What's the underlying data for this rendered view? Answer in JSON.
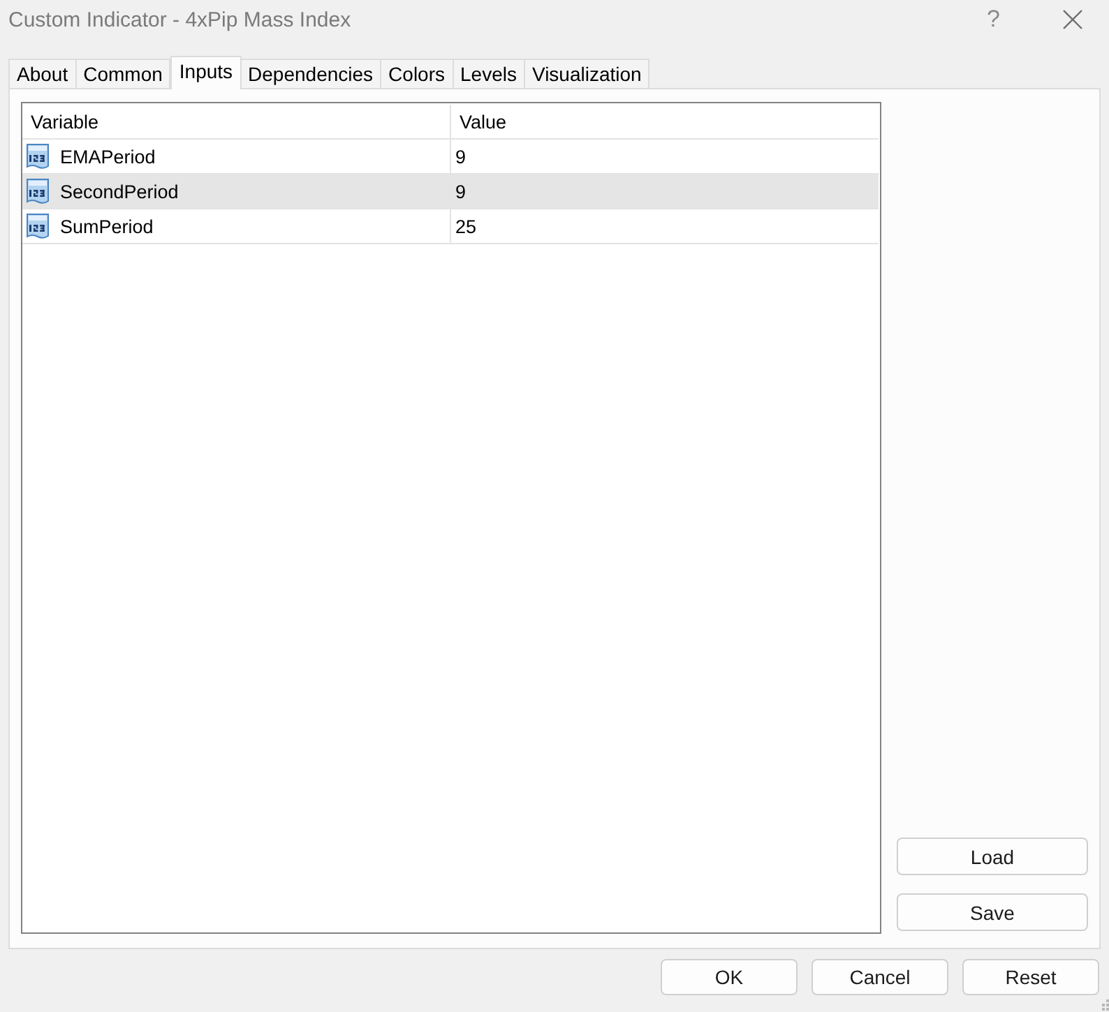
{
  "window": {
    "title": "Custom Indicator - 4xPip Mass Index",
    "help": "?"
  },
  "tabs": [
    {
      "label": "About",
      "selected": false
    },
    {
      "label": "Common",
      "selected": false
    },
    {
      "label": "Inputs",
      "selected": true
    },
    {
      "label": "Dependencies",
      "selected": false
    },
    {
      "label": "Colors",
      "selected": false
    },
    {
      "label": "Levels",
      "selected": false
    },
    {
      "label": "Visualization",
      "selected": false
    }
  ],
  "inputs_table": {
    "columns": [
      "Variable",
      "Value"
    ],
    "rows": [
      {
        "variable": "EMAPeriod",
        "value": "9",
        "selected": false
      },
      {
        "variable": "SecondPeriod",
        "value": "9",
        "selected": true
      },
      {
        "variable": "SumPeriod",
        "value": "25",
        "selected": false
      }
    ]
  },
  "side_buttons": [
    "Load",
    "Save"
  ],
  "buttons": [
    "OK",
    "Cancel",
    "Reset"
  ]
}
